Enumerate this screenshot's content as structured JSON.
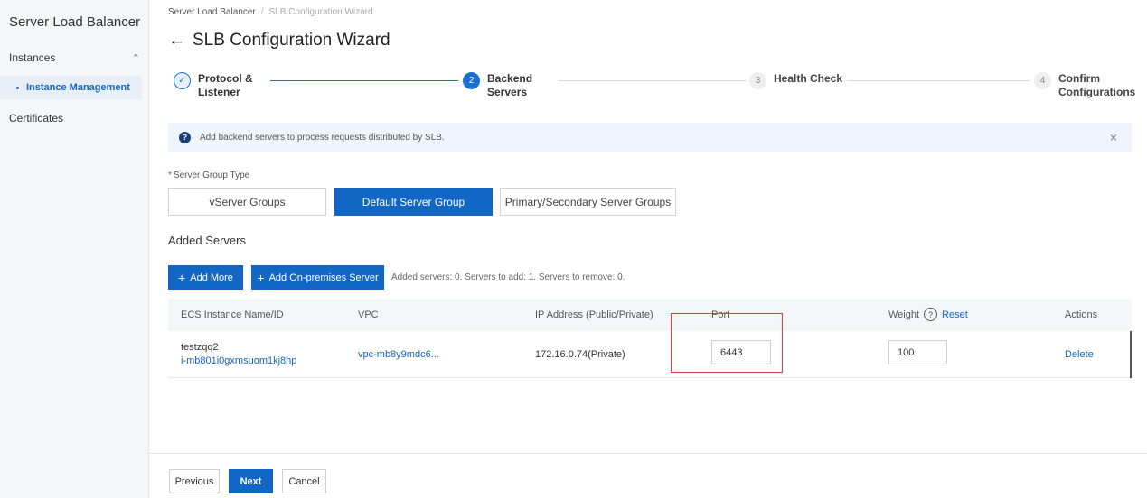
{
  "sidebar": {
    "title": "Server Load Balancer",
    "group": "Instances",
    "active_item": "Instance Management",
    "item": "Certificates"
  },
  "breadcrumb": {
    "root": "Server Load Balancer",
    "separator": "/",
    "current": "SLB Configuration Wizard"
  },
  "page": {
    "back": "←",
    "title": "SLB Configuration Wizard"
  },
  "steps": [
    {
      "number": "✓",
      "line1": "Protocol &",
      "line2": "Listener",
      "state": "done"
    },
    {
      "number": "2",
      "line1": "Backend",
      "line2": "Servers",
      "state": "active"
    },
    {
      "number": "3",
      "line1": "Health Check",
      "line2": "",
      "state": "todo"
    },
    {
      "number": "4",
      "line1": "Confirm",
      "line2": "Configurations",
      "state": "todo"
    }
  ],
  "notice": {
    "icon": "?",
    "text": "Add backend servers to process requests distributed by SLB.",
    "close": "×"
  },
  "server_group": {
    "label": "Server Group Type",
    "required": "*",
    "options": [
      "vServer Groups",
      "Default Server Group",
      "Primary/Secondary Server Groups"
    ],
    "selected": "Default Server Group"
  },
  "added_servers": {
    "title": "Added Servers",
    "add_more": "Add More",
    "add_onprem": "Add On-premises Server",
    "plus": "+",
    "summary": "Added servers: 0. Servers to add: 1. Servers to remove: 0."
  },
  "table": {
    "headers": {
      "name": "ECS Instance Name/ID",
      "vpc": "VPC",
      "ip": "IP Address (Public/Private)",
      "port": "Port",
      "weight": "Weight",
      "weight_help": "?",
      "reset": "Reset",
      "actions": "Actions"
    },
    "rows": [
      {
        "name": "testzqq2",
        "id": "i-mb801i0gxmsuom1kj8hp",
        "vpc": "vpc-mb8y9mdc6...",
        "ip": "172.16.0.74(Private)",
        "port": "6443",
        "weight": "100",
        "action": "Delete"
      }
    ]
  },
  "footer": {
    "previous": "Previous",
    "next": "Next",
    "cancel": "Cancel"
  },
  "colors": {
    "primary": "#1266c4",
    "highlight": "#e53935"
  }
}
